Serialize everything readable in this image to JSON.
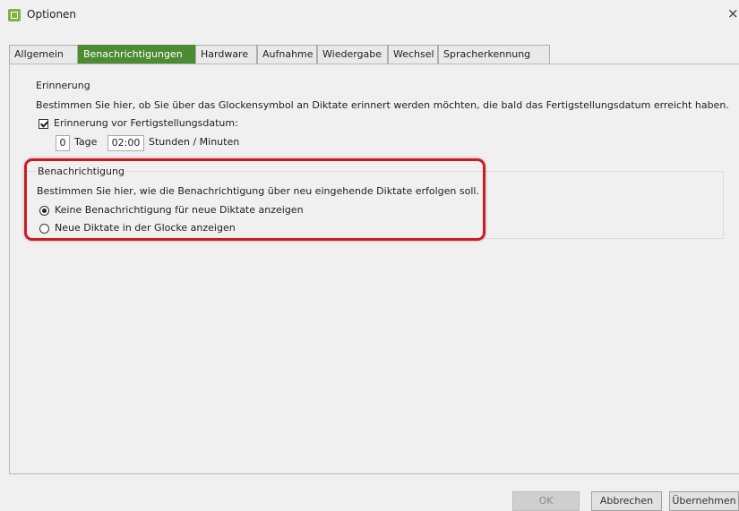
{
  "window": {
    "title": "Optionen",
    "close_glyph": "×",
    "icon": "app-icon",
    "accent": "#4d8b33"
  },
  "tabs": [
    {
      "label": "Allgemein",
      "active": false
    },
    {
      "label": "Benachrichtigungen",
      "active": true
    },
    {
      "label": "Hardware",
      "active": false
    },
    {
      "label": "Aufnahme",
      "active": false
    },
    {
      "label": "Wiedergabe",
      "active": false
    },
    {
      "label": "Wechsel",
      "active": false
    },
    {
      "label": "Spracherkennung",
      "active": false
    }
  ],
  "reminder": {
    "title": "Erinnerung",
    "description": "Bestimmen Sie hier, ob Sie über das Glockensymbol an Diktate erinnert werden möchten, die bald das Fertigstellungsdatum erreicht haben.",
    "checkbox_label": "Erinnerung vor Fertigstellungsdatum:",
    "checked": true,
    "days_value": "0",
    "days_unit": "Tage",
    "time_value": "02:00",
    "time_unit": "Stunden / Minuten"
  },
  "notification": {
    "title": "Benachrichtigung",
    "description": "Bestimmen Sie hier, wie die Benachrichtigung über neu eingehende Diktate erfolgen soll.",
    "options": [
      {
        "label": "Keine Benachrichtigung für neue Diktate anzeigen",
        "selected": true
      },
      {
        "label": "Neue Diktate in der Glocke anzeigen",
        "selected": false
      }
    ],
    "highlight_color": "#d11a20"
  },
  "buttons": {
    "ok": "OK",
    "cancel": "Abbrechen",
    "apply": "Übernehmen"
  }
}
